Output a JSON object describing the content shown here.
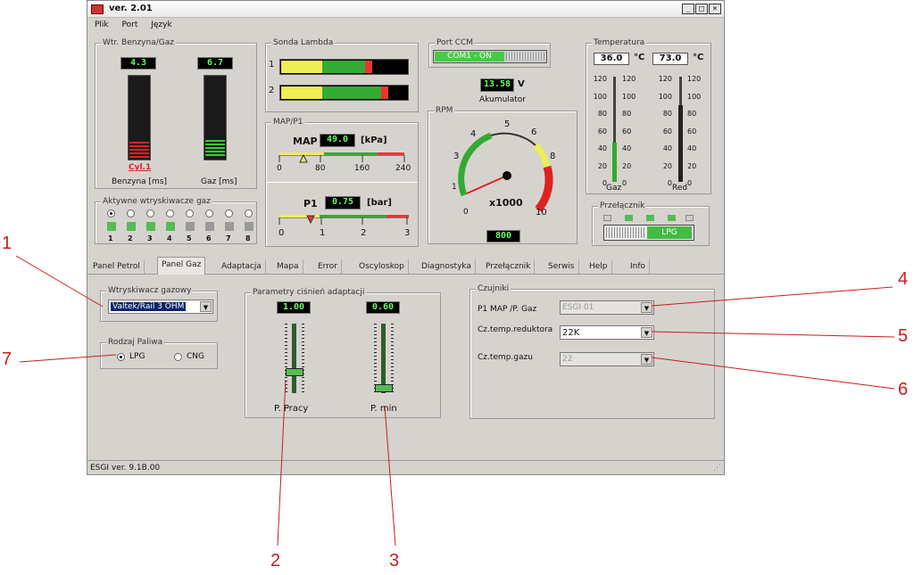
{
  "window": {
    "title": "ver. 2.01",
    "min": "_",
    "max": "□",
    "close": "×"
  },
  "menu": [
    "Plik",
    "Port",
    "Język"
  ],
  "wtr": {
    "label": "Wtr. Benzyna/Gaz",
    "benz_val": "4.3",
    "gaz_val": "6.7",
    "cyl": "Cyl.1",
    "benz_lbl": "Benzyna [ms]",
    "gaz_lbl": "Gaz [ms]"
  },
  "lambda": {
    "label": "Sonda Lambda",
    "r1": "1",
    "r2": "2"
  },
  "port": {
    "label": "Port CCM",
    "value": "COM1 - ON"
  },
  "akumulator": {
    "value": "13.58",
    "unit": "V",
    "label": "Akumulator"
  },
  "temp": {
    "label": "Temperatura",
    "gaz_val": "36.0",
    "red_val": "73.0",
    "unit": "°C",
    "ticks_left": [
      "120",
      "100",
      "80",
      "60",
      "40",
      "20",
      "0"
    ],
    "ticks_right": [
      "120",
      "100",
      "80",
      "60",
      "40",
      "20",
      "0"
    ],
    "ticks_right2": [
      "120",
      "100",
      "80",
      "60",
      "40",
      "20",
      "0"
    ],
    "ticks_r_left": [
      "120",
      "100",
      "80",
      "60",
      "40",
      "20",
      "0"
    ],
    "gaz_lbl": "Gaz",
    "red_lbl": "Red"
  },
  "mapp1": {
    "label": "MAP/P1",
    "map_lbl": "MAP",
    "map_val": "49.0",
    "map_unit": "[kPa]",
    "map_ticks": [
      "0",
      "80",
      "160",
      "240"
    ],
    "p1_lbl": "P1",
    "p1_val": "0.75",
    "p1_unit": "[bar]",
    "p1_ticks": [
      "0",
      "1",
      "2",
      "3"
    ]
  },
  "rpm": {
    "label": "RPM",
    "ticks": [
      "0",
      "1",
      "2",
      "3",
      "4",
      "5",
      "6",
      "7",
      "8",
      "9",
      "10"
    ],
    "mult": "x1000",
    "value": "800"
  },
  "wtrysk": {
    "label": "Aktywne wtryskiwacze gaz",
    "nums": [
      "1",
      "2",
      "3",
      "4",
      "5",
      "6",
      "7",
      "8"
    ]
  },
  "przel": {
    "label": "Przełącznik",
    "value": "LPG"
  },
  "tabs": [
    "Panel Petrol",
    "Panel Gaz",
    "Adaptacja",
    "Mapa",
    "Error",
    "Oscyloskop",
    "Diagnostyka",
    "Przełącznik",
    "Serwis",
    "Help",
    "Info"
  ],
  "wtryskiwacz": {
    "label": "Wtryskiwacz gazowy",
    "value": "Valtek/Rail 3 OHM"
  },
  "paliwo": {
    "label": "Rodzaj Paliwa",
    "lpg": "LPG",
    "cng": "CNG"
  },
  "param": {
    "label": "Parametry ciśnień adaptacji",
    "praca_val": "1.00",
    "min_val": "0.60",
    "praca_lbl": "P. Pracy",
    "min_lbl": "P. min"
  },
  "czujniki": {
    "label": "Czujniki",
    "r1": "P1 MAP /P. Gaz",
    "v1": "ESGI 01",
    "r2": "Cz.temp.reduktora",
    "v2": "22K",
    "r3": "Cz.temp.gazu",
    "v3": "22"
  },
  "status": "ESGI ver. 9.1B.00",
  "annotations": [
    "1",
    "2",
    "3",
    "4",
    "5",
    "6",
    "7"
  ]
}
